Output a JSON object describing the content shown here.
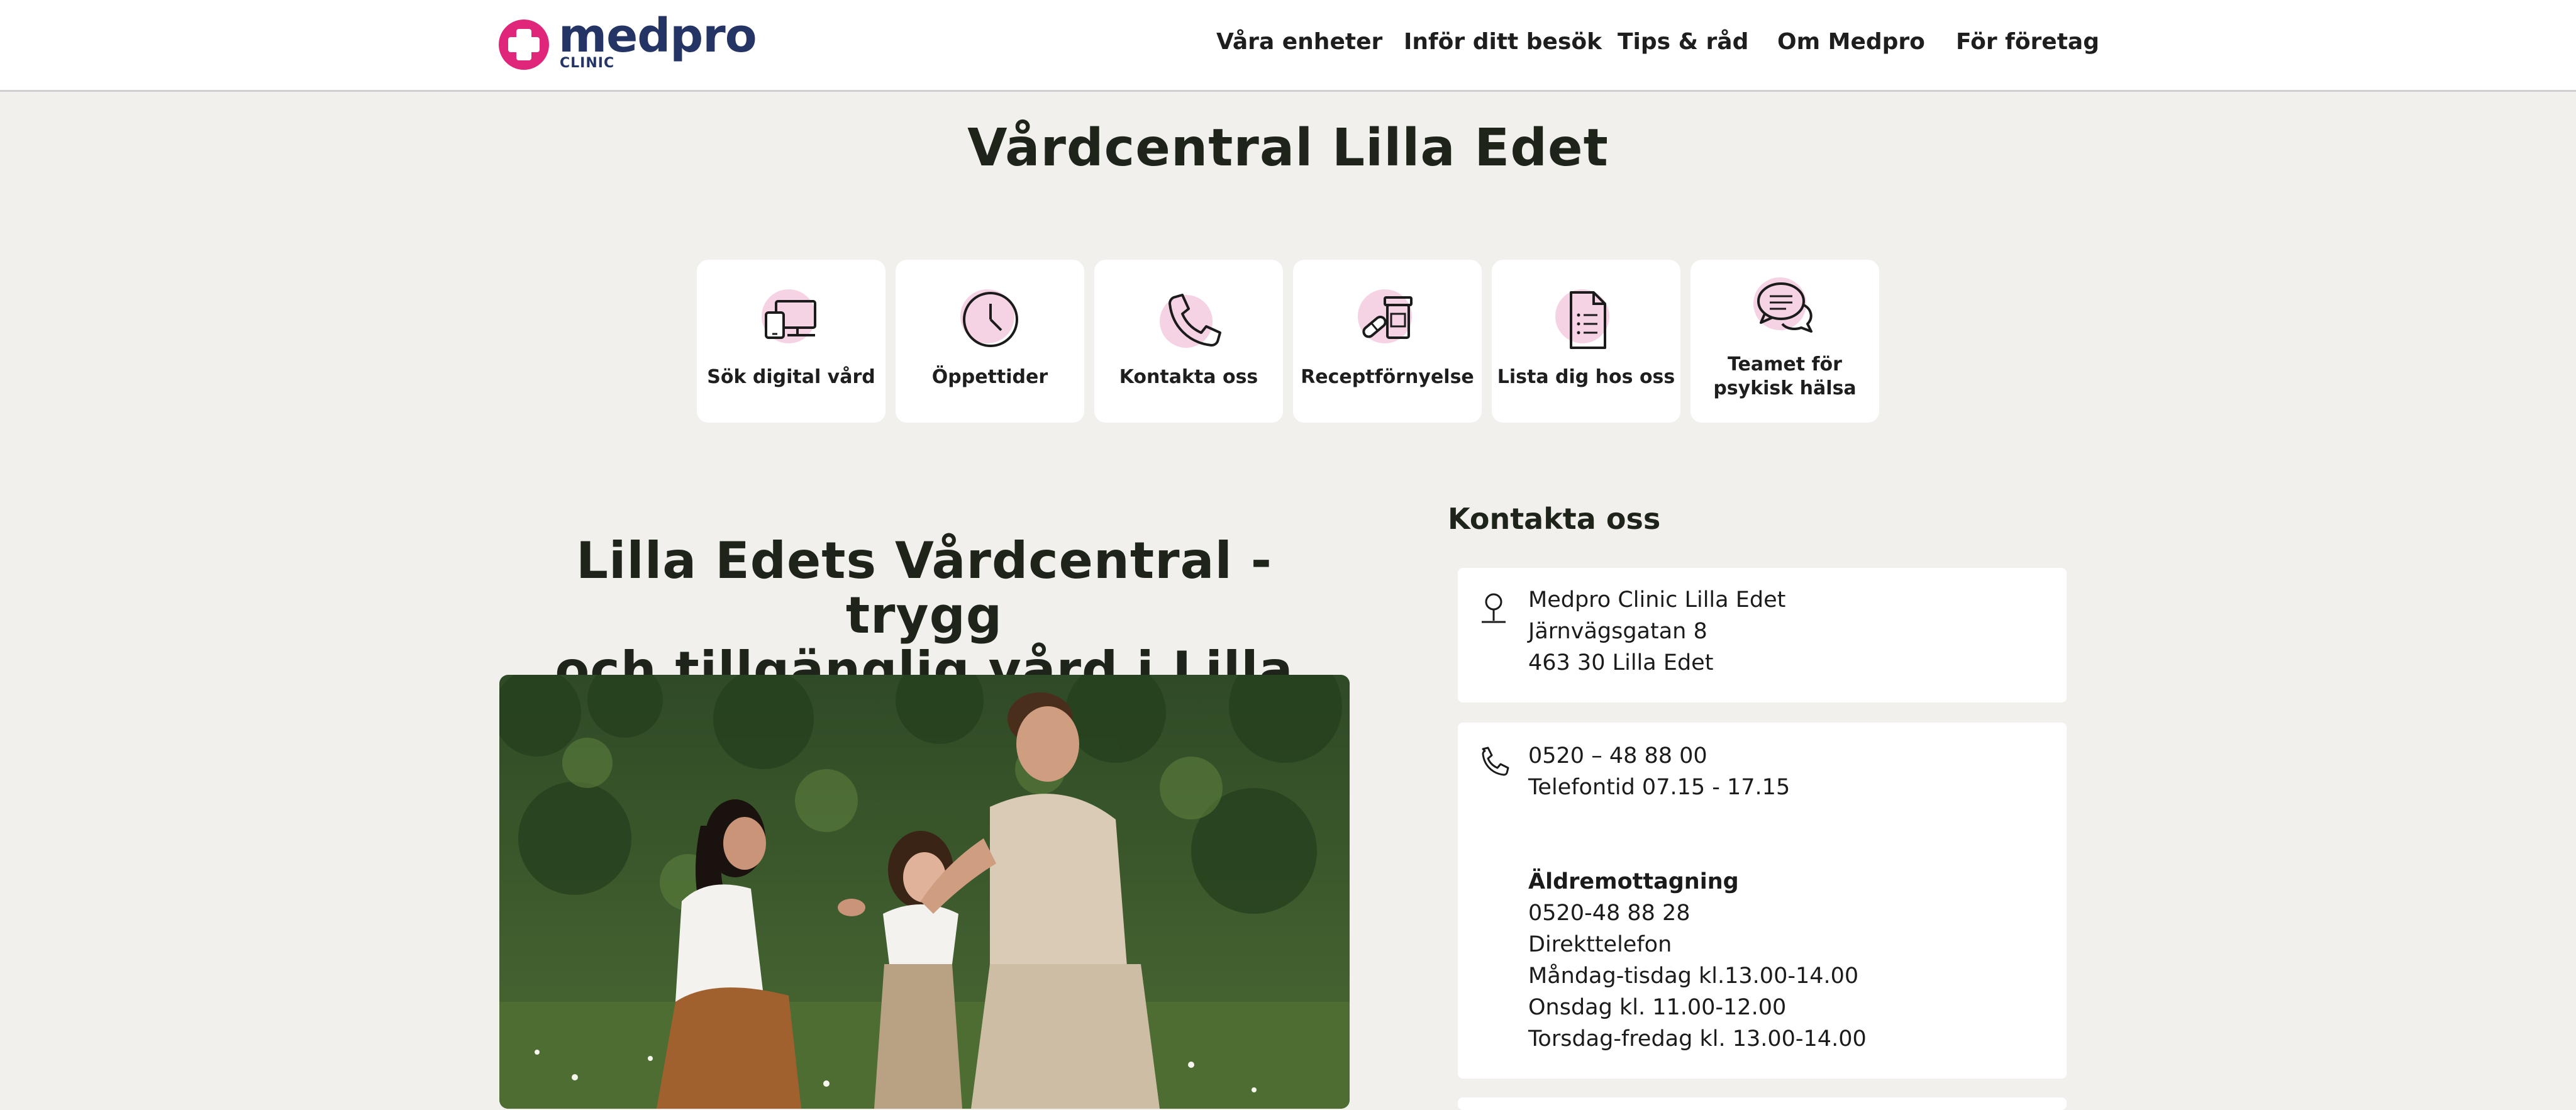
{
  "brand": {
    "name": "medpro",
    "sub": "CLINIC",
    "color": "#243465",
    "accent": "#e0267a"
  },
  "nav": [
    {
      "label": "Våra enheter"
    },
    {
      "label": "Inför ditt besök"
    },
    {
      "label": "Tips & råd"
    },
    {
      "label": "Om Medpro"
    },
    {
      "label": "För företag"
    }
  ],
  "page_title": "Vårdcentral Lilla Edet",
  "quick_links": [
    {
      "label": "Sök digital vård",
      "icon": "devices-icon"
    },
    {
      "label": "Öppettider",
      "icon": "clock-icon"
    },
    {
      "label": "Kontakta oss",
      "icon": "phone-icon"
    },
    {
      "label": "Receptförnyelse",
      "icon": "pills-icon"
    },
    {
      "label": "Lista dig hos oss",
      "icon": "document-icon"
    },
    {
      "label_line1": "Teamet för",
      "label_line2": "psykisk hälsa",
      "icon": "chat-bubbles-icon"
    }
  ],
  "section": {
    "heading_line1": "Lilla Edets Vårdcentral - trygg",
    "heading_line2": "och tillgänglig vård i Lilla Edet"
  },
  "contact": {
    "heading": "Kontakta oss",
    "address": {
      "name": "Medpro Clinic Lilla Edet",
      "street": "Järnvägsgatan 8",
      "postal": "463 30 Lilla Edet"
    },
    "phone": {
      "number": "0520 – 48 88 00",
      "hours": "Telefontid 07.15 - 17.15",
      "elder_title": "Äldremottagning",
      "elder_number": "0520-48 88 28",
      "elder_label": "Direkttelefon",
      "elder_hours_1": "Måndag-tisdag kl.13.00-14.00",
      "elder_hours_2": "Onsdag kl. 11.00-12.00",
      "elder_hours_3": "Torsdag-fredag kl. 13.00-14.00"
    }
  }
}
